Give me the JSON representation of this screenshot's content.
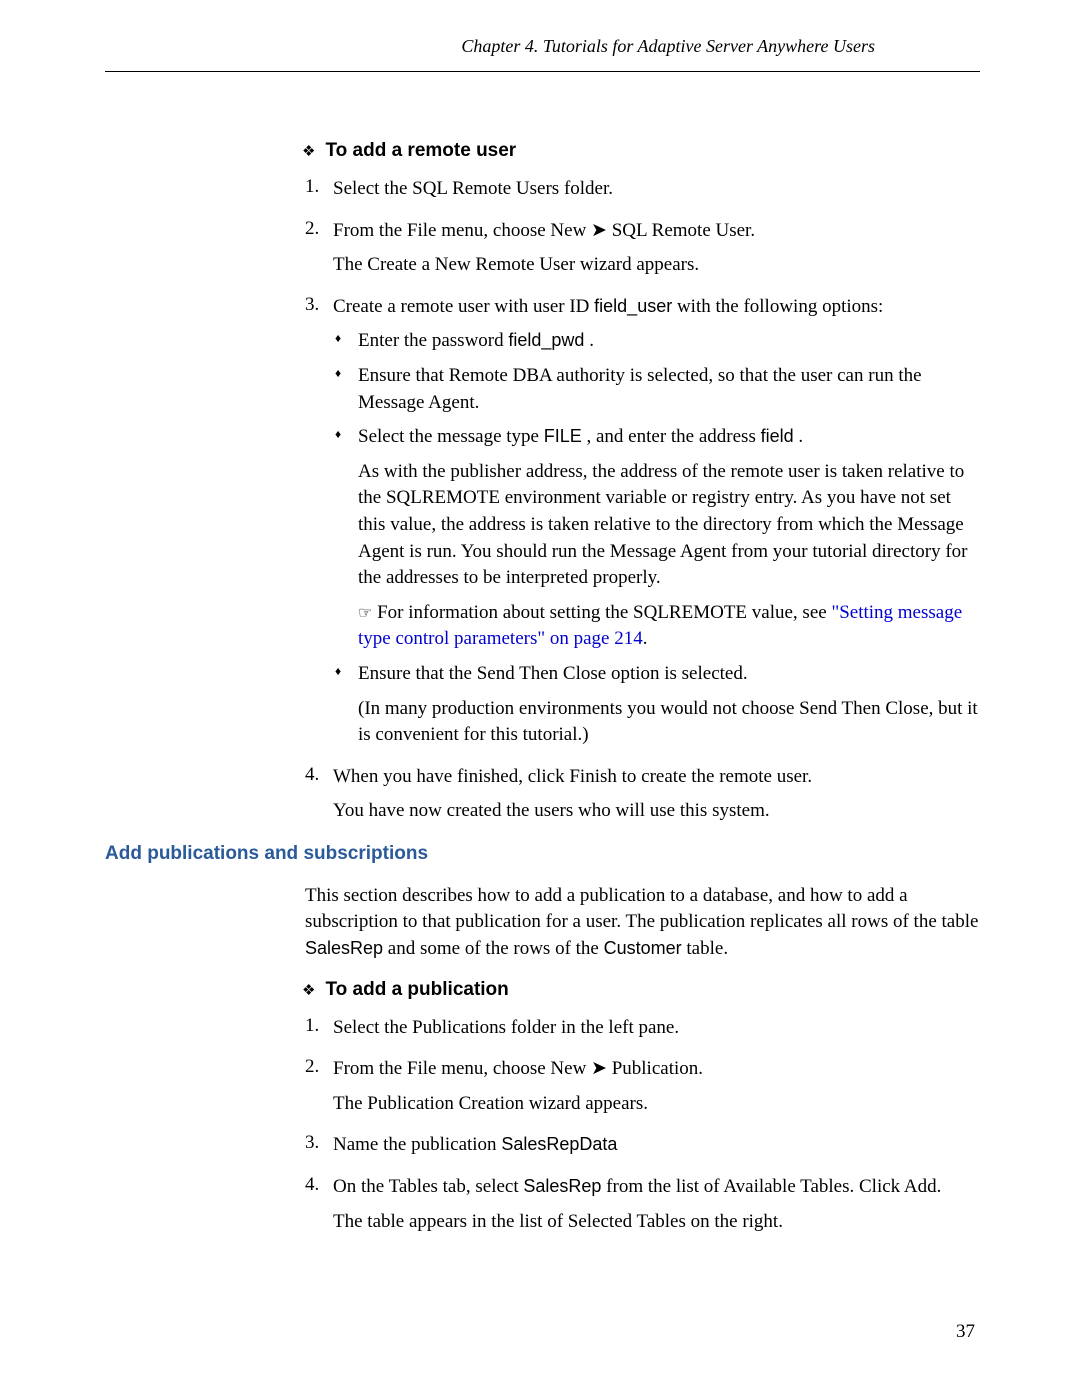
{
  "header": "Chapter 4.  Tutorials for Adaptive Server Anywhere Users",
  "section1": {
    "title": "To add a remote user",
    "items": [
      {
        "num": "1.",
        "text": "Select the SQL Remote Users folder."
      },
      {
        "num": "2.",
        "text": "From the File menu, choose New ➤ SQL Remote User.",
        "sub": "The Create a New Remote User wizard appears."
      },
      {
        "num": "3.",
        "text_before": "Create a remote user with user ID ",
        "code1": "ﬁeld_user",
        "text_after": " with the following options:",
        "bullets": [
          {
            "pre": "Enter the password ",
            "code": "ﬁeld_pwd",
            "post": " ."
          },
          {
            "text": "Ensure that Remote DBA authority is selected, so that the user can run the Message Agent."
          },
          {
            "pre": "Select the message type ",
            "code": "FILE",
            "mid": " , and enter the address ",
            "code2": "ﬁeld",
            "post": " .",
            "para": "As with the publisher address, the address of the remote user is taken relative to the SQLREMOTE environment variable or registry entry. As you have not set this value, the address is taken relative to the directory from which the Message Agent is run. You should run the Message Agent from your tutorial directory for the addresses to be interpreted properly.",
            "info_pre": "For information about setting the SQLREMOTE value, see ",
            "link": "\"Setting message type control parameters\" on page 214",
            "info_post": "."
          },
          {
            "text": "Ensure that the Send Then Close option is selected.",
            "para": "(In many production environments you would not choose Send Then Close, but it is convenient for this tutorial.)"
          }
        ]
      },
      {
        "num": "4.",
        "text": "When you have finished, click Finish to create the remote user.",
        "sub": "You have now created the users who will use this system."
      }
    ]
  },
  "subsection": {
    "heading": "Add publications and subscriptions",
    "para_before": "This section describes how to add a publication to a database, and how to add a subscription to that publication for a user. The publication replicates all rows of the table ",
    "code1": "SalesRep",
    "para_mid": " and some of the rows of the ",
    "code2": "Customer",
    "para_after": " table."
  },
  "section2": {
    "title": "To add a publication",
    "items": [
      {
        "num": "1.",
        "text": "Select the Publications folder in the left pane."
      },
      {
        "num": "2.",
        "text": "From the File menu, choose New ➤ Publication.",
        "sub": "The Publication Creation wizard appears."
      },
      {
        "num": "3.",
        "pre": "Name the publication ",
        "code": "SalesRepData"
      },
      {
        "num": "4.",
        "pre": "On the Tables tab, select ",
        "code": "SalesRep",
        "post": " from the list of Available Tables. Click Add.",
        "sub": "The table appears in the list of Selected Tables on the right."
      }
    ]
  },
  "page_number": "37"
}
